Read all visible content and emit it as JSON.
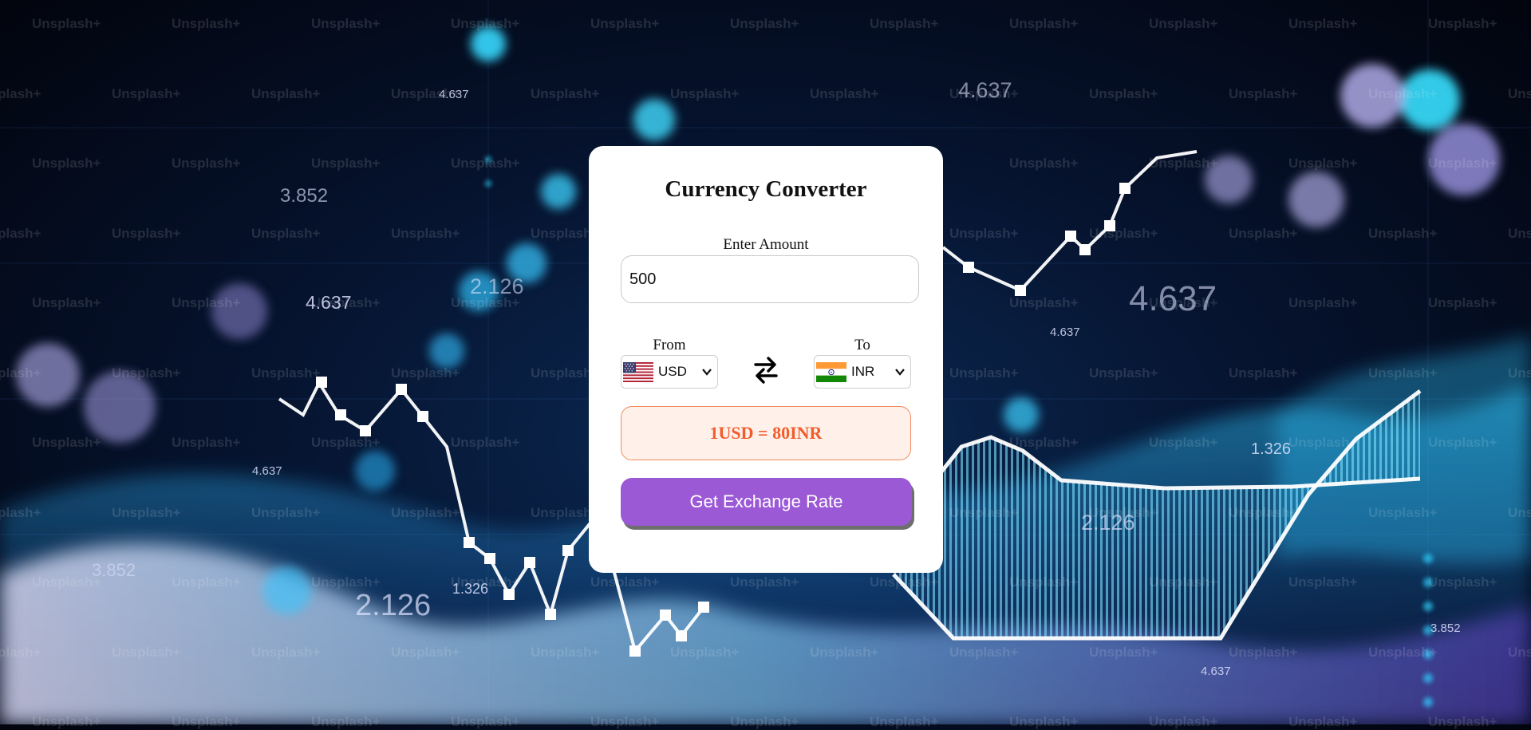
{
  "background": {
    "watermark_text": "Unsplash+",
    "numbers": [
      "4.637",
      "3.852",
      "4.637",
      "2.126",
      "4.637",
      "4.637",
      "4.637",
      "1.326",
      "2.126",
      "3.852",
      "2.126",
      "1.326",
      "4.637",
      "3.852",
      "4.637"
    ]
  },
  "converter": {
    "title": "Currency Converter",
    "amount_label": "Enter Amount",
    "amount_value": "500",
    "from_label": "From",
    "from_currency": "USD",
    "to_label": "To",
    "to_currency": "INR",
    "result_text": "1USD = 80INR",
    "button_label": "Get Exchange Rate"
  },
  "icons": {
    "swap": "swap-arrows-icon",
    "from_flag": "us-flag-icon",
    "to_flag": "india-flag-icon",
    "dropdown": "chevron-down-icon"
  },
  "colors": {
    "button": "#9b59d6",
    "result_text": "#f25c2b",
    "result_background": "#fff1ea",
    "result_border": "#f08a5d"
  }
}
